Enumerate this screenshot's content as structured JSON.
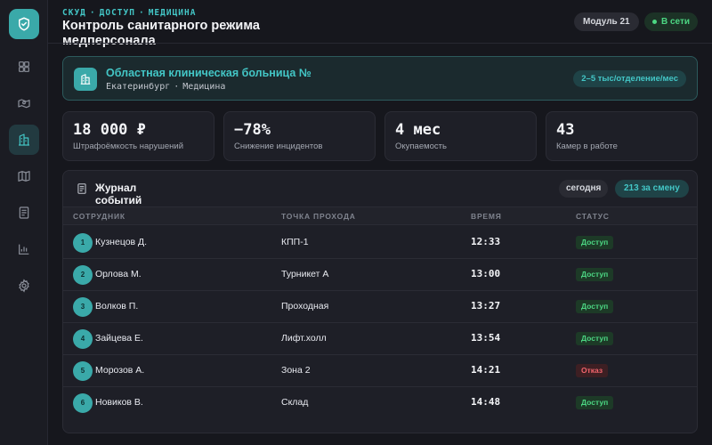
{
  "header": {
    "breadcrumbs": [
      "СКУД",
      "ДОСТУП",
      "МЕДИЦИНА"
    ],
    "title": "Контроль санитарного режима медперсонала",
    "module": "Модуль 21",
    "status": "В сети"
  },
  "sidebar": {
    "items": [
      {
        "icon": "dashboard-icon"
      },
      {
        "icon": "map-pin-icon"
      },
      {
        "icon": "hospital-icon",
        "active": true
      },
      {
        "icon": "map-icon"
      },
      {
        "icon": "document-icon"
      },
      {
        "icon": "bar-chart-icon"
      },
      {
        "icon": "gear-icon"
      }
    ]
  },
  "org": {
    "name": "Областная клиническая больница №",
    "city": "Екатеринбург",
    "sector": "Медицина",
    "rate": "2–5 тыс/отделение/мес"
  },
  "stats": [
    {
      "value": "18 000 ₽",
      "label": "Штрафоёмкость нарушений"
    },
    {
      "value": "−78%",
      "label": "Снижение инцидентов"
    },
    {
      "value": "4 мес",
      "label": "Окупаемость"
    },
    {
      "value": "43",
      "label": "Камер в работе"
    }
  ],
  "events": {
    "title": "Журнал событий",
    "today": "сегодня",
    "count": "213 за смену",
    "columns": [
      "СОТРУДНИК",
      "ТОЧКА ПРОХОДА",
      "ВРЕМЯ",
      "СТАТУС"
    ],
    "rows": [
      {
        "n": "1",
        "name": "Кузнецов Д.",
        "point": "КПП-1",
        "time": "12:33",
        "status": "Доступ"
      },
      {
        "n": "2",
        "name": "Орлова М.",
        "point": "Турникет А",
        "time": "13:00",
        "status": "Доступ"
      },
      {
        "n": "3",
        "name": "Волков П.",
        "point": "Проходная",
        "time": "13:27",
        "status": "Доступ"
      },
      {
        "n": "4",
        "name": "Зайцева Е.",
        "point": "Лифт.холл",
        "time": "13:54",
        "status": "Доступ"
      },
      {
        "n": "5",
        "name": "Морозов А.",
        "point": "Зона 2",
        "time": "14:21",
        "status": "Отказ"
      },
      {
        "n": "6",
        "name": "Новиков В.",
        "point": "Склад",
        "time": "14:48",
        "status": "Доступ"
      }
    ]
  },
  "colors": {
    "accent": "#43c6c6",
    "ok": "#4cd783",
    "deny": "#f2646c",
    "background": "#16171d"
  }
}
